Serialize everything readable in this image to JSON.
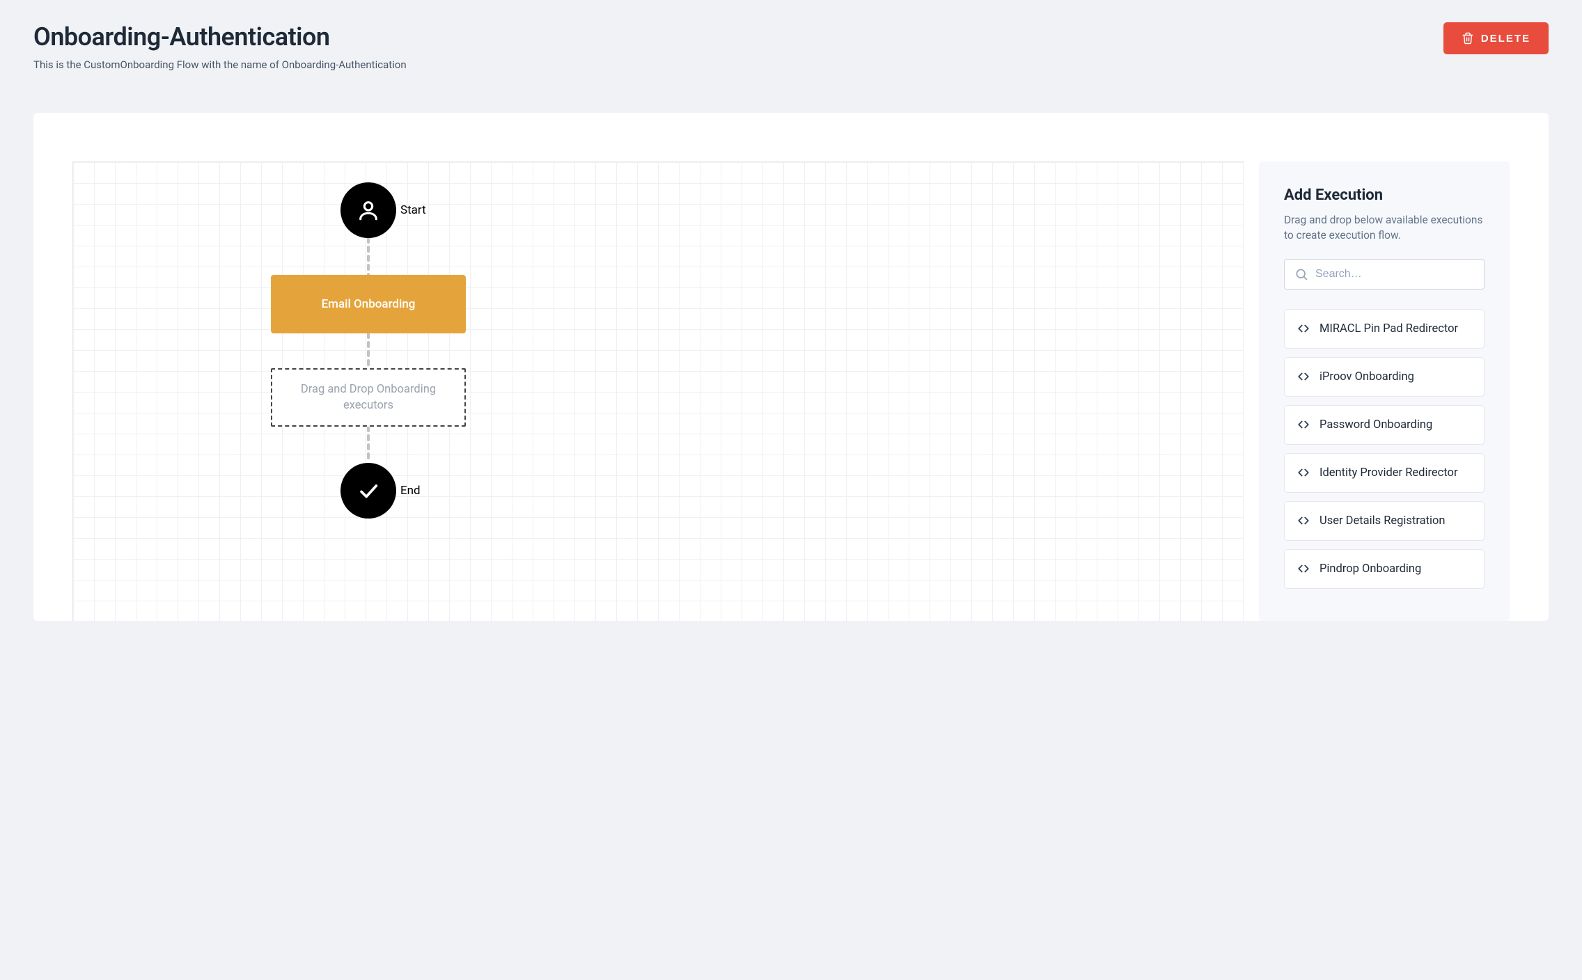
{
  "header": {
    "title": "Onboarding-Authentication",
    "subtitle": "This is the CustomOnboarding Flow with the name of Onboarding-Authentication",
    "delete_label": "DELETE"
  },
  "canvas": {
    "start_label": "Start",
    "end_label": "End",
    "execution_node_label": "Email Onboarding",
    "drop_placeholder": "Drag and Drop Onboarding executors"
  },
  "panel": {
    "title": "Add Execution",
    "description": "Drag and drop below available executions to create execution flow.",
    "search_placeholder": "Search…",
    "items": [
      {
        "label": "MIRACL Pin Pad Redirector"
      },
      {
        "label": "iProov Onboarding"
      },
      {
        "label": "Password Onboarding"
      },
      {
        "label": "Identity Provider Redirector"
      },
      {
        "label": "User Details Registration"
      },
      {
        "label": "Pindrop Onboarding"
      }
    ]
  }
}
